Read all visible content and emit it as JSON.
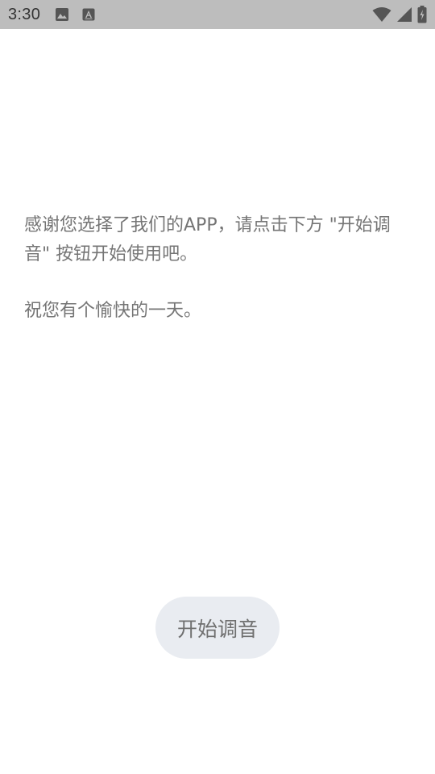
{
  "status_bar": {
    "time": "3:30",
    "left_icons": [
      "image-icon",
      "text-icon"
    ],
    "right_icons": [
      "wifi-icon",
      "signal-icon",
      "battery-charging-icon"
    ]
  },
  "message": {
    "paragraph1": "感谢您选择了我们的APP，请点击下方 \"开始调音\" 按钮开始使用吧。",
    "paragraph2": "祝您有个愉快的一天。"
  },
  "start_button": {
    "label": "开始调音"
  }
}
